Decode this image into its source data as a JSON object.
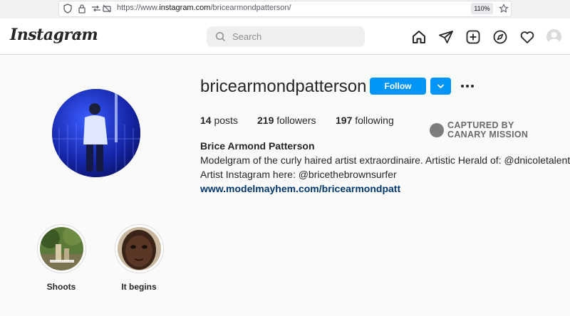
{
  "browser": {
    "url_prefix": "https://www.",
    "url_host": "instagram.com",
    "url_path": "/bricearmondpatterson/",
    "zoom": "110%"
  },
  "header": {
    "logo": "Instagram",
    "search_placeholder": "Search"
  },
  "profile": {
    "username": "bricearmondpatterson",
    "follow_label": "Follow",
    "posts_count": "14",
    "posts_label": "posts",
    "followers_count": "219",
    "followers_label": "followers",
    "following_count": "197",
    "following_label": "following",
    "full_name": "Brice Armond Patterson",
    "bio_line1": "Modelgram of the curly haired artist extraordinaire. Artistic Herald of: @dnicoletalent",
    "bio_line2": "Artist Instagram here: @bricethebrownsurfer",
    "link": "www.modelmayhem.com/bricearmondpatt"
  },
  "watermark": {
    "line1": "CAPTURED BY",
    "line2": "CANARY MISSION"
  },
  "highlights": [
    {
      "label": "Shoots"
    },
    {
      "label": "It begins"
    }
  ],
  "colors": {
    "follow_blue": "#0095f6",
    "link_blue": "#00376b",
    "background": "#fafafa"
  }
}
